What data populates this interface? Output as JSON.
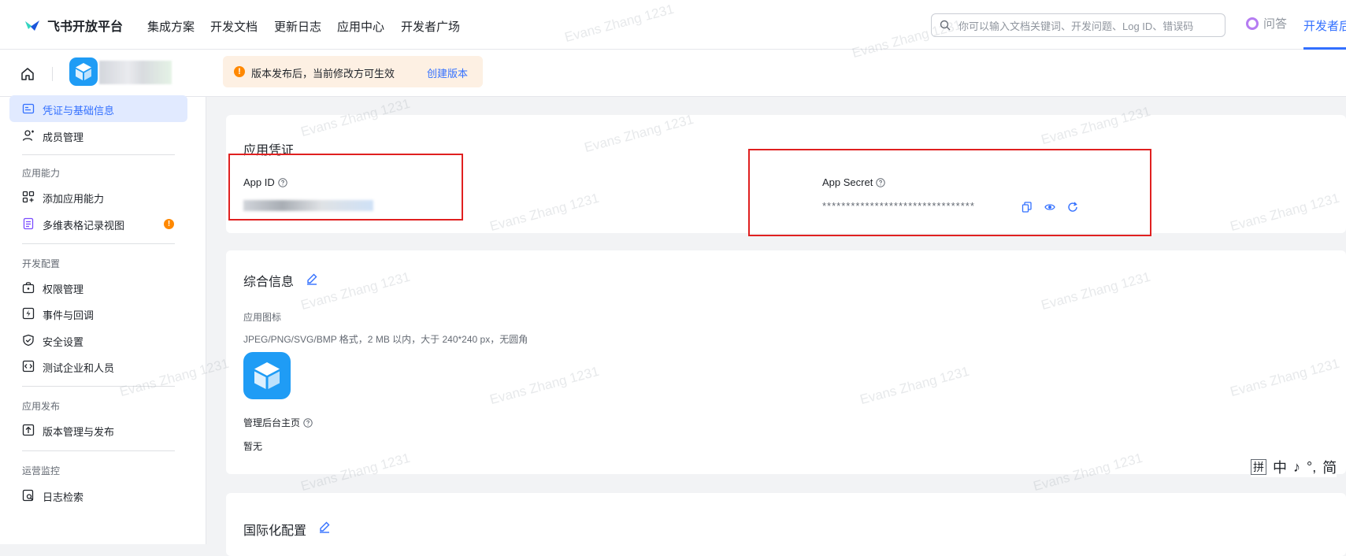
{
  "brand": {
    "name": "飞书开放平台"
  },
  "nav": {
    "links": [
      "集成方案",
      "开发文档",
      "更新日志",
      "应用中心",
      "开发者广场"
    ],
    "search_placeholder": "你可以输入文档关键词、开发问题、Log ID、错误码",
    "ask_label": "问答",
    "dev_backend_label": "开发者后"
  },
  "notice": {
    "text": "版本发布后，当前修改方可生效",
    "link": "创建版本"
  },
  "sidebar": {
    "items": [
      {
        "label": "凭证与基础信息",
        "icon": "id-card-icon",
        "active": true
      },
      {
        "label": "成员管理",
        "icon": "member-icon"
      }
    ],
    "groups": [
      {
        "title": "应用能力",
        "items": [
          {
            "label": "添加应用能力",
            "icon": "apps-add-icon"
          },
          {
            "label": "多维表格记录视图",
            "icon": "table-view-icon",
            "badge": "!"
          }
        ]
      },
      {
        "title": "开发配置",
        "items": [
          {
            "label": "权限管理",
            "icon": "permission-icon"
          },
          {
            "label": "事件与回调",
            "icon": "event-icon"
          },
          {
            "label": "安全设置",
            "icon": "shield-icon"
          },
          {
            "label": "测试企业和人员",
            "icon": "code-icon"
          }
        ]
      },
      {
        "title": "应用发布",
        "items": [
          {
            "label": "版本管理与发布",
            "icon": "upload-icon"
          }
        ]
      },
      {
        "title": "运营监控",
        "items": [
          {
            "label": "日志检索",
            "icon": "log-icon"
          }
        ]
      }
    ]
  },
  "credentials": {
    "title": "应用凭证",
    "app_id_label": "App ID",
    "app_secret_label": "App Secret",
    "app_secret_masked": "********************************"
  },
  "info": {
    "title": "综合信息",
    "icon_label": "应用图标",
    "icon_hint": "JPEG/PNG/SVG/BMP 格式，2 MB 以内，大于 240*240 px，无圆角",
    "admin_home_label": "管理后台主页",
    "admin_home_value": "暂无"
  },
  "i18n": {
    "title": "国际化配置"
  },
  "ime": {
    "items": [
      "拼",
      "中",
      "♪",
      "°,",
      "简"
    ]
  },
  "watermark": "Evans Zhang 1231",
  "colors": {
    "accent": "#3370ff",
    "warning": "#ff8800",
    "highlight_box": "#e02020"
  }
}
